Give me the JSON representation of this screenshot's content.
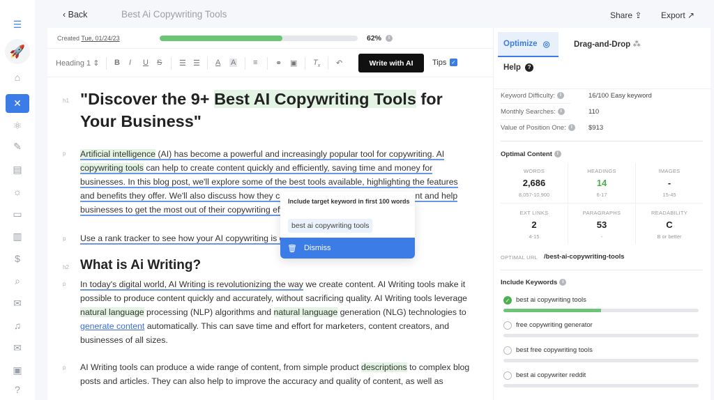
{
  "sidebar": {
    "items": [
      {
        "name": "menu-icon",
        "glyph": "☰"
      },
      {
        "name": "rocket-logo-icon",
        "glyph": "🚀"
      },
      {
        "name": "home-icon",
        "glyph": "⌂"
      },
      {
        "name": "tools-icon",
        "glyph": "✕"
      },
      {
        "name": "atom-icon",
        "glyph": "⚛"
      },
      {
        "name": "pen-icon",
        "glyph": "✎"
      },
      {
        "name": "document-icon",
        "glyph": "▤"
      },
      {
        "name": "lightbulb-icon",
        "glyph": "☼"
      },
      {
        "name": "card-icon",
        "glyph": "▭"
      },
      {
        "name": "file-search-icon",
        "glyph": "▥"
      },
      {
        "name": "money-bag-icon",
        "glyph": "$"
      },
      {
        "name": "magnify-icon",
        "glyph": "⌕"
      },
      {
        "name": "mail-open-icon",
        "glyph": "✉"
      },
      {
        "name": "music-file-icon",
        "glyph": "♫"
      },
      {
        "name": "mail-icon",
        "glyph": "✉"
      },
      {
        "name": "save-icon",
        "glyph": "▣"
      },
      {
        "name": "help-icon",
        "glyph": "?"
      }
    ]
  },
  "topbar": {
    "back_label": "Back",
    "document_title": "Best Ai Copywriting Tools",
    "share_label": "Share",
    "export_label": "Export"
  },
  "editor": {
    "created_label": "Created",
    "created_date": "Tue, 01/24/23",
    "progress_percent": 62,
    "progress_label": "62%",
    "toolbar": {
      "heading_select": "Heading 1",
      "write_ai_label": "Write with AI",
      "tips_label": "Tips",
      "tips_checked": true
    },
    "tags": {
      "h1": "h1",
      "p": "p",
      "h2": "h2"
    },
    "h1_before": "\"Discover the 9+ ",
    "h1_highlight": "Best AI Copywriting Tools",
    "h1_after": " for Your Business\"",
    "p1": {
      "hl1": "Artificial intelligence",
      "t1": " (AI) has become a powerful and increasingly popular tool for copywriting. AI ",
      "hl2": "copywriting tools",
      "t2": " can help to create content quickly and efficiently, saving time and money for businesses. In this blog post, we'll explore some of the best tools available, highlighting the features and benefits they offer. We'll also discuss how they can help improve the quality of content and help businesses to get the most out of their copywriting efforts."
    },
    "p2": "Use a rank tracker to see how your AI copywriting is going.",
    "h2": "What is Ai Writing?",
    "p3": {
      "u1": "In today's digital world, AI Writing is revolutionizing the way",
      "t1": " we create content. AI Writing tools make it possible to produce content quickly and accurately, without sacrificing quality. AI Writing tools leverage ",
      "hl1": "natural language",
      "t2": " processing (NLP) algorithms and ",
      "hl2": "natural language",
      "t3": " generation (NLG) technologies to ",
      "link": "generate content",
      "t4": " automatically. This can save time and effort for marketers, content creators, and businesses of all sizes."
    },
    "p4": {
      "t1": "AI Writing tools can produce a wide range of content, from simple product ",
      "hl1": "descriptions",
      "t2": " to complex blog posts and articles. They can also help to improve the accuracy and quality of content, as well as"
    }
  },
  "popup": {
    "title": "Include target keyword in first 100 words",
    "keyword": "best ai copywriting tools",
    "dismiss_label": "Dismiss"
  },
  "panel": {
    "tabs": {
      "optimize": "Optimize",
      "drag_drop": "Drag-and-Drop",
      "help": "Help"
    },
    "stats": [
      {
        "label": "Keyword Difficulty:",
        "value": "16/100 Easy keyword"
      },
      {
        "label": "Monthly Searches:",
        "value": "110"
      },
      {
        "label": "Value of Position One:",
        "value": "$913"
      }
    ],
    "optimal_content_title": "Optimal Content",
    "metrics": [
      {
        "label": "WORDS",
        "value": "2,686",
        "range": "8,057-10,900",
        "green": false
      },
      {
        "label": "HEADINGS",
        "value": "14",
        "range": "6-17",
        "green": true
      },
      {
        "label": "IMAGES",
        "value": "-",
        "range": "15-45",
        "green": false
      },
      {
        "label": "EXT LINKS",
        "value": "2",
        "range": "4-15",
        "green": false
      },
      {
        "label": "PARAGRAPHS",
        "value": "53",
        "range": "-",
        "green": false
      },
      {
        "label": "READABILITY",
        "value": "C",
        "range": "B or better",
        "green": false
      }
    ],
    "optimal_url_label": "OPTIMAL URL",
    "optimal_url": "/best-ai-copywriting-tools",
    "include_keywords_title": "Include Keywords",
    "keywords": [
      {
        "text": "best ai copywriting tools",
        "done": true,
        "progress": 0.5
      },
      {
        "text": "free copywriting generator",
        "done": false,
        "progress": 0
      },
      {
        "text": "best free copywriting tools",
        "done": false,
        "progress": 0
      },
      {
        "text": "best ai copywriter reddit",
        "done": false,
        "progress": 0
      }
    ]
  },
  "colors": {
    "accent": "#3b7ce6",
    "progress_green": "#6cc477",
    "highlight_green": "#e3f4e4",
    "underline_blue": "#6a96e8"
  }
}
